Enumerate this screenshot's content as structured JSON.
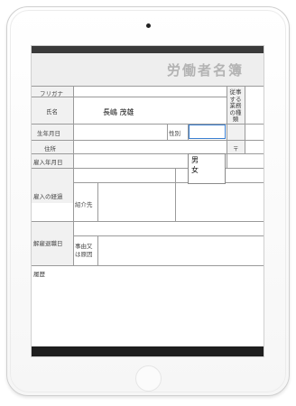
{
  "form": {
    "title": "労働者名簿",
    "labels": {
      "furigana": "フリガナ",
      "name": "氏名",
      "birthdate": "生年月日",
      "gender": "性別",
      "address": "住所",
      "hire_date": "雇入年月日",
      "hire_history": "雇入の経過",
      "introducer": "紹介先",
      "dismissal_date": "解雇退職日",
      "reason_line1": "事由又",
      "reason_line2": "は原因",
      "history": "履歴",
      "job_type_lines": [
        "従事",
        "する",
        "業務",
        "の種",
        "類"
      ],
      "postal_mark": "〒"
    },
    "values": {
      "name": "長嶋 茂雄",
      "gender_selected": ""
    },
    "gender_options": [
      "男",
      "女"
    ]
  }
}
